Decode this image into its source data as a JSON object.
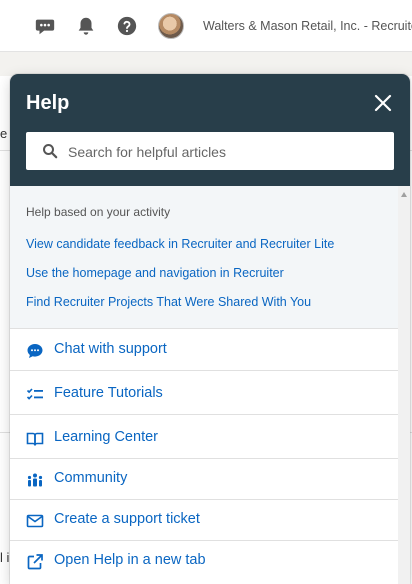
{
  "topbar": {
    "company": "Walters & Mason Retail, Inc. - Recruiter",
    "icons": [
      "messaging-icon",
      "notifications-bell-icon",
      "help-question-icon"
    ]
  },
  "background": {
    "fragment_1": "e",
    "fragment_2": "l i"
  },
  "help": {
    "title": "Help",
    "search": {
      "placeholder": "Search for helpful articles",
      "value": ""
    },
    "activity": {
      "heading": "Help based on your activity",
      "links": [
        "View candidate feedback in Recruiter and Recruiter Lite",
        "Use the homepage and navigation in Recruiter",
        "Find Recruiter Projects That Were Shared With You"
      ]
    },
    "menu": [
      {
        "label": "Chat with support",
        "icon": "chat-bubble-icon"
      },
      {
        "label": "Feature Tutorials",
        "icon": "checklist-icon"
      },
      {
        "label": "Learning Center",
        "icon": "book-icon"
      },
      {
        "label": "Community",
        "icon": "people-icon"
      },
      {
        "label": "Create a support ticket",
        "icon": "envelope-icon"
      },
      {
        "label": "Open Help in a new tab",
        "icon": "external-link-icon"
      }
    ]
  },
  "colors": {
    "header": "#283e4a",
    "link": "#0a66c2",
    "activity_bg": "#f3f6f8"
  }
}
